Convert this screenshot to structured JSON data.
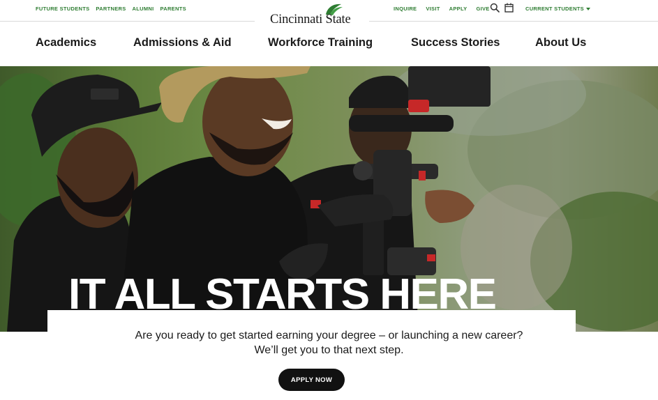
{
  "utility_nav": {
    "left_links": [
      "FUTURE STUDENTS",
      "PARTNERS",
      "ALUMNI",
      "PARENTS"
    ],
    "right_links": [
      "INQUIRE",
      "VISIT",
      "APPLY",
      "GIVE"
    ],
    "current_students": "CURRENT STUDENTS"
  },
  "logo": {
    "text": "Cincinnati State"
  },
  "main_nav": [
    "Academics",
    "Admissions & Aid",
    "Workforce Training",
    "Success Stories",
    "About Us"
  ],
  "hero": {
    "headline": "IT ALL STARTS HERE",
    "intro_line1": "Are you ready to get started earning your degree – or launching a new career?",
    "intro_line2": "We’ll get you to that next step.",
    "cta_label": "APPLY NOW"
  },
  "colors": {
    "brand_green": "#2e7d32",
    "cta_black": "#111111"
  },
  "icons": [
    "search-icon",
    "calendar-icon",
    "chevron-down-icon"
  ]
}
